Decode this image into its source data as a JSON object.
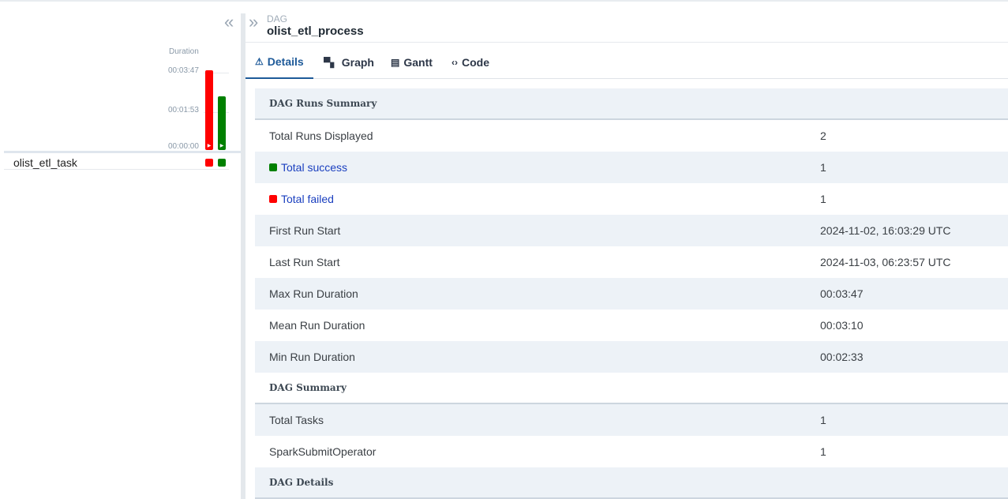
{
  "grid": {
    "duration_label": "Duration",
    "ticks": [
      "00:03:47",
      "00:01:53",
      "00:00:00"
    ],
    "runs": [
      {
        "state": "failed",
        "color": "#ff0000",
        "duration_fraction": 1.0
      },
      {
        "state": "success",
        "color": "#008000",
        "duration_fraction": 0.67
      }
    ],
    "task": {
      "name": "olist_etl_task"
    }
  },
  "header": {
    "kicker": "DAG",
    "title": "olist_etl_process"
  },
  "tabs": [
    {
      "label": "Details",
      "icon": "warning-triangle-icon",
      "active": true
    },
    {
      "label": "Graph",
      "icon": "graph-icon",
      "active": false
    },
    {
      "label": "Gantt",
      "icon": "gantt-icon",
      "active": false
    },
    {
      "label": "Code",
      "icon": "code-icon",
      "active": false
    }
  ],
  "details": {
    "runs_summary": {
      "heading": "DAG Runs Summary",
      "total_runs_label": "Total Runs Displayed",
      "total_runs_value": "2",
      "success_label": "Total success",
      "success_value": "1",
      "failed_label": "Total failed",
      "failed_value": "1",
      "first_start_label": "First Run Start",
      "first_start_value": "2024-11-02, 16:03:29 UTC",
      "last_start_label": "Last Run Start",
      "last_start_value": "2024-11-03, 06:23:57 UTC",
      "max_label": "Max Run Duration",
      "max_value": "00:03:47",
      "mean_label": "Mean Run Duration",
      "mean_value": "00:03:10",
      "min_label": "Min Run Duration",
      "min_value": "00:02:33"
    },
    "dag_summary": {
      "heading": "DAG Summary",
      "total_tasks_label": "Total Tasks",
      "total_tasks_value": "1",
      "operator_label": "SparkSubmitOperator",
      "operator_value": "1"
    },
    "dag_details": {
      "heading": "DAG Details"
    }
  },
  "colors": {
    "success": "#008000",
    "failed": "#ff0000",
    "accent": "#1e5a99"
  }
}
